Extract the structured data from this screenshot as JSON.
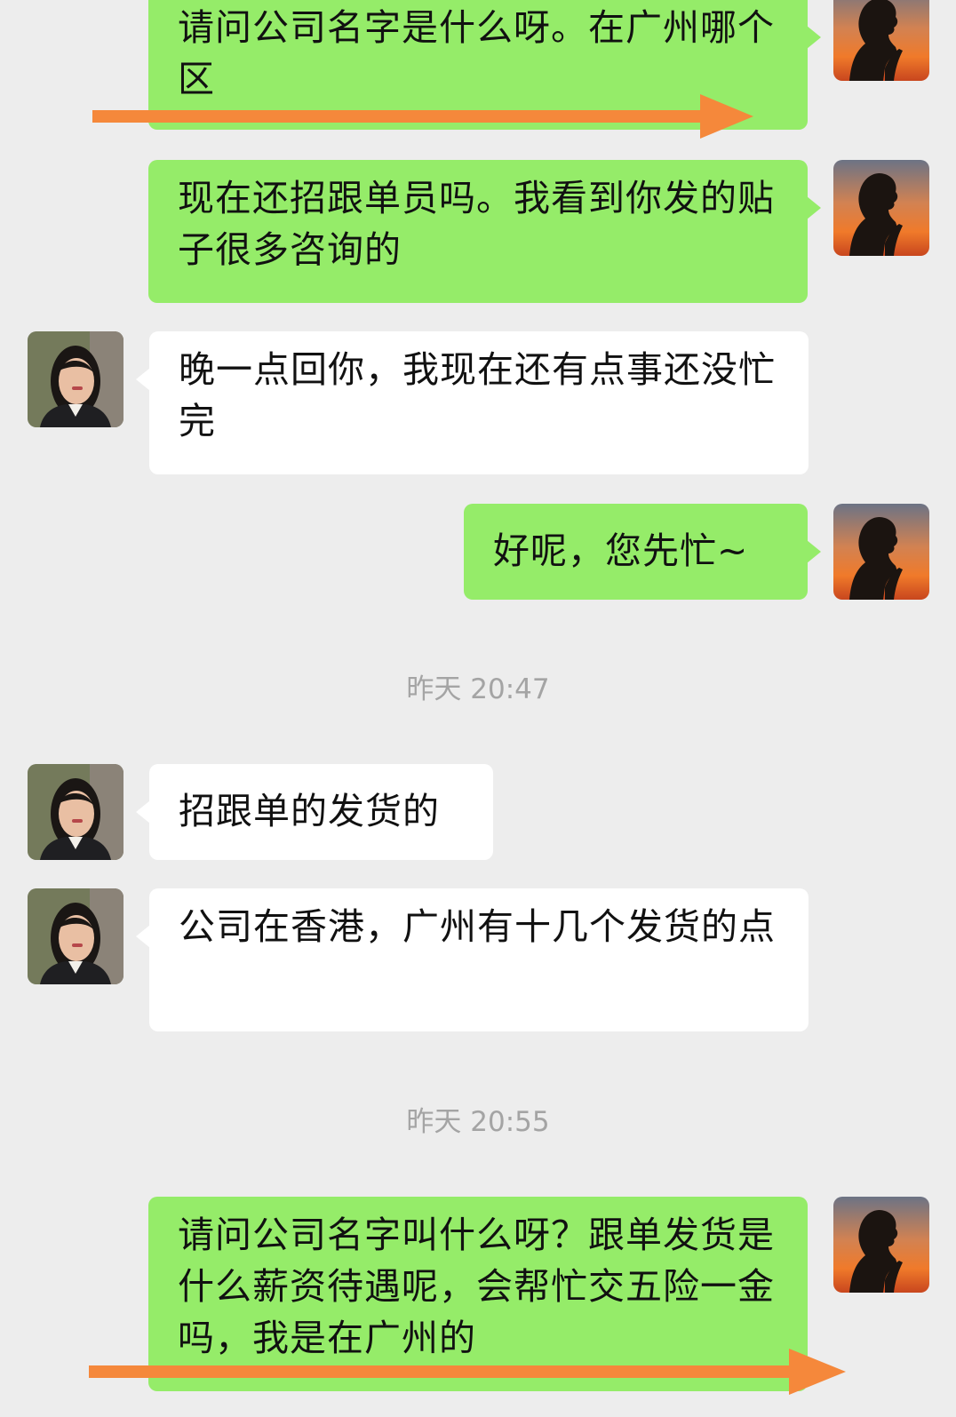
{
  "messages": [
    {
      "side": "out",
      "text": "请问公司名字是什么呀。在广州哪个区"
    },
    {
      "side": "out",
      "text": "现在还招跟单员吗。我看到你发的贴子很多咨询的"
    },
    {
      "side": "in",
      "text": "晚一点回你，我现在还有点事还没忙完"
    },
    {
      "side": "out",
      "text": "好呢，您先忙~"
    },
    {
      "side": "in",
      "text": "招跟单的发货的"
    },
    {
      "side": "in",
      "text": "公司在香港，广州有十几个发货的点"
    },
    {
      "side": "out",
      "text": "请问公司名字叫什么呀？跟单发货是什么薪资待遇呢，会帮忙交五险一金吗，我是在广州的"
    }
  ],
  "timestamps": [
    "昨天 20:47",
    "昨天 20:55"
  ],
  "icons": {
    "self_avatar": "silhouette-sunset-avatar",
    "contact_avatar": "woman-portrait-avatar",
    "annotation": "orange-arrow"
  },
  "colors": {
    "background": "#ededed",
    "outgoing_bubble": "#95ec69",
    "incoming_bubble": "#ffffff",
    "timestamp_text": "#a4a4a4",
    "annotation_arrow": "#f5883b"
  }
}
